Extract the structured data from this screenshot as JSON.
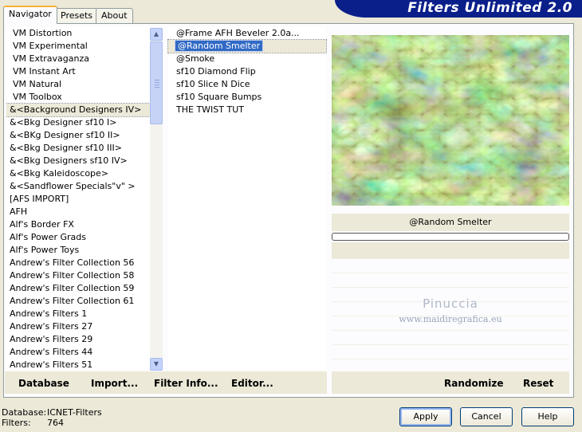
{
  "window": {
    "title": "Filters Unlimited 2.0"
  },
  "tabs": [
    {
      "label": "Navigator",
      "active": true
    },
    {
      "label": "Presets",
      "active": false
    },
    {
      "label": "About",
      "active": false
    }
  ],
  "categories": [
    "VM Distortion",
    "VM Experimental",
    "VM Extravaganza",
    "VM Instant Art",
    "VM Natural",
    "VM Toolbox",
    "&<Background Designers IV>",
    "&<Bkg Designer sf10 I>",
    "&<BKg Designer sf10 II>",
    "&<Bkg Designer sf10 III>",
    "&<Bkg Designers sf10 IV>",
    "&<Bkg Kaleidoscope>",
    "&<Sandflower Specials\"v\" >",
    "[AFS IMPORT]",
    "AFH",
    "Alf's Border FX",
    "Alf's Power Grads",
    "Alf's Power Toys",
    "Andrew's Filter Collection 56",
    "Andrew's Filter Collection 58",
    "Andrew's Filter Collection 59",
    "Andrew's Filter Collection 61",
    "Andrew's Filters 1",
    "Andrew's Filters 27",
    "Andrew's Filters 29",
    "Andrew's Filters 44",
    "Andrew's Filters 51"
  ],
  "filters": [
    "@Frame AFH Beveler 2.0a...",
    "@Random Smelter",
    "@Smoke",
    "sf10 Diamond Flip",
    "sf10 Slice N Dice",
    "sf10 Square Bumps",
    "THE TWIST TUT"
  ],
  "preview": {
    "filter_name": "@Random Smelter",
    "watermark_name": "Pinuccia",
    "watermark_url": "www.maidiregrafica.eu"
  },
  "left_buttons": {
    "database": "Database",
    "import": "Import...",
    "filter_info": "Filter Info...",
    "editor": "Editor..."
  },
  "right_buttons": {
    "randomize": "Randomize",
    "reset": "Reset"
  },
  "status": {
    "database_label": "Database:",
    "database_value": "ICNET-Filters",
    "filters_label": "Filters:",
    "filters_value": "764"
  },
  "dialog_buttons": {
    "apply": "Apply",
    "cancel": "Cancel",
    "help": "Help"
  },
  "scrollbar": {
    "up_icon": "▲",
    "down_icon": "▼"
  }
}
